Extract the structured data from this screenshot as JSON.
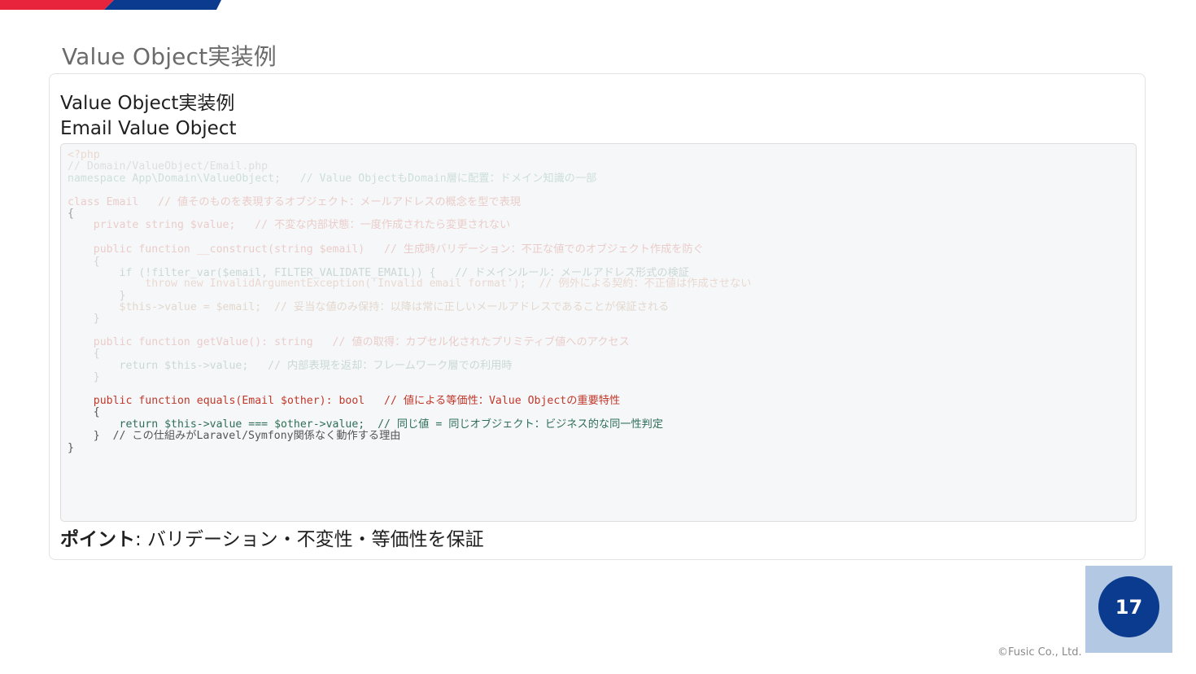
{
  "slide": {
    "title": "Value Object実装例",
    "page_number": "17",
    "copyright": "©Fusic Co., Ltd."
  },
  "card": {
    "heading": "Value Object実装例",
    "subheading": "Email Value Object",
    "point_label": "ポイント",
    "point_text": ": バリデーション・不変性・等価性を保証"
  },
  "code": {
    "l1": "<?php",
    "l2": "// Domain/ValueObject/Email.php",
    "l3": "namespace App\\Domain\\ValueObject;   // Value ObjectもDomain層に配置：ドメイン知識の一部",
    "l4": "class Email   // 値そのものを表現するオブジェクト：メールアドレスの概念を型で表現",
    "l5": "{",
    "l6": "    private string $value;   // 不変な内部状態：一度作成されたら変更されない",
    "l7": "    public function __construct(string $email)   // 生成時バリデーション：不正な値でのオブジェクト作成を防ぐ",
    "l8": "    {",
    "l9": "        if (!filter_var($email, FILTER_VALIDATE_EMAIL)) {   // ドメインルール：メールアドレス形式の検証",
    "l10": "            throw new InvalidArgumentException('Invalid email format');  // 例外による契約：不正値は作成させない",
    "l11": "        }",
    "l12": "        $this->value = $email;  // 妥当な値のみ保持：以降は常に正しいメールアドレスであることが保証される",
    "l13": "    }",
    "l14": "    public function getValue(): string   // 値の取得：カプセル化されたプリミティブ値へのアクセス",
    "l15": "    {",
    "l16": "        return $this->value;   // 内部表現を返却：フレームワーク層での利用時",
    "l17": "    }",
    "l18": "    public function equals(Email $other): bool   // 値による等価性：Value Objectの重要特性",
    "l19": "    {",
    "l20": "        return $this->value === $other->value;  // 同じ値 = 同じオブジェクト：ビジネス的な同一性判定",
    "l21": "    }  // この仕組みがLaravel/Symfony関係なく動作する理由",
    "l22": "}"
  },
  "colors": {
    "brand_red": "#e8243c",
    "brand_blue": "#0b3b8f",
    "page_box": "#b3c8e2"
  }
}
